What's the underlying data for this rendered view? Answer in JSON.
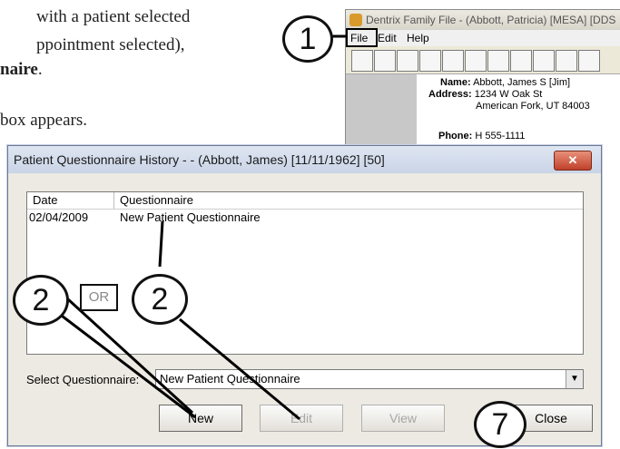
{
  "doc": {
    "line1": "with a patient selected",
    "line2": "ppointment selected),",
    "line3_bold": "naire",
    "line3_end": ".",
    "line4": "box appears."
  },
  "bg_window": {
    "title": "Dentrix Family File - (Abbott, Patricia) [MESA] [DDS",
    "menu": [
      "File",
      "Edit",
      "Help"
    ],
    "info": {
      "name_label": "Name:",
      "name": "Abbott, James S [Jim]",
      "address_label": "Address:",
      "address1": "1234 W Oak St",
      "address2": "American Fork, UT  84003",
      "phone_label": "Phone:",
      "phone": "H 555-1111"
    }
  },
  "dialog": {
    "title": "Patient Questionnaire History -  - (Abbott, James) [11/11/1962] [50]",
    "close_glyph": "✕",
    "columns": [
      "Date",
      "Questionnaire"
    ],
    "rows": [
      {
        "date": "02/04/2009",
        "questionnaire": "New Patient Questionnaire"
      }
    ],
    "select_label": "Select Questionnaire:",
    "select_value": "New Patient Questionnaire",
    "buttons": {
      "new": "New",
      "edit": "Edit",
      "view": "View",
      "close": "Close"
    }
  },
  "callouts": {
    "c1": "1",
    "c2a": "2",
    "c2b": "2",
    "c7": "7",
    "or": "OR"
  }
}
